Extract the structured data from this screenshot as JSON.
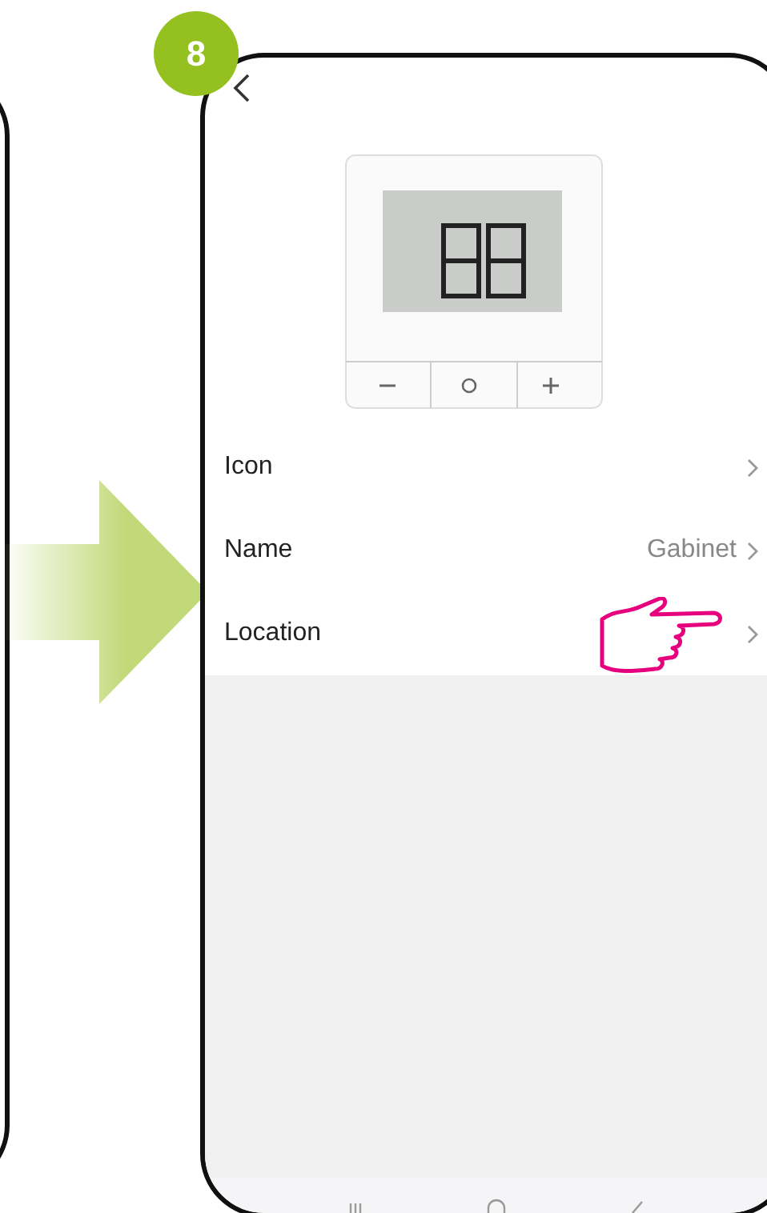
{
  "step": "8",
  "screen": {
    "rows": [
      {
        "label": "Icon",
        "pointed": false
      },
      {
        "label": "Name",
        "value": "Gabinet",
        "pointed": false
      },
      {
        "label": "Location",
        "pointed": true
      }
    ]
  }
}
